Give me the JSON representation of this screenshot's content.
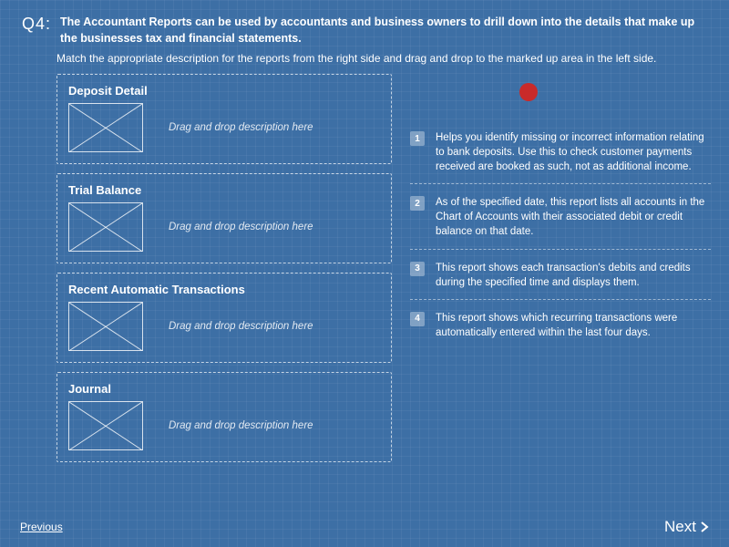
{
  "question": {
    "number": "Q4:",
    "title": "The Accountant Reports can be used by accountants and business owners to drill down into the details that make up the businesses tax and financial statements.",
    "instruction": "Match the appropriate description for the reports from the right side and drag and drop to the marked up area in the left side."
  },
  "dropzones": [
    {
      "title": "Deposit Detail",
      "hint": "Drag and drop description here"
    },
    {
      "title": "Trial Balance",
      "hint": "Drag and drop description here"
    },
    {
      "title": "Recent Automatic Transactions",
      "hint": "Drag and drop description here"
    },
    {
      "title": "Journal",
      "hint": "Drag and drop description here"
    }
  ],
  "descriptions": [
    {
      "num": "1",
      "text": "Helps you identify missing or incorrect information relating to bank deposits. Use this to check customer payments received are booked as such, not as additional income."
    },
    {
      "num": "2",
      "text": "As of the specified date, this report lists all accounts in the Chart of Accounts with their associated debit or credit balance on that date."
    },
    {
      "num": "3",
      "text": "This report shows each transaction's debits and credits during the specified time and displays them."
    },
    {
      "num": "4",
      "text": "This report shows which recurring transactions were automatically entered within the last four days."
    }
  ],
  "nav": {
    "previous": "Previous",
    "next": "Next"
  }
}
